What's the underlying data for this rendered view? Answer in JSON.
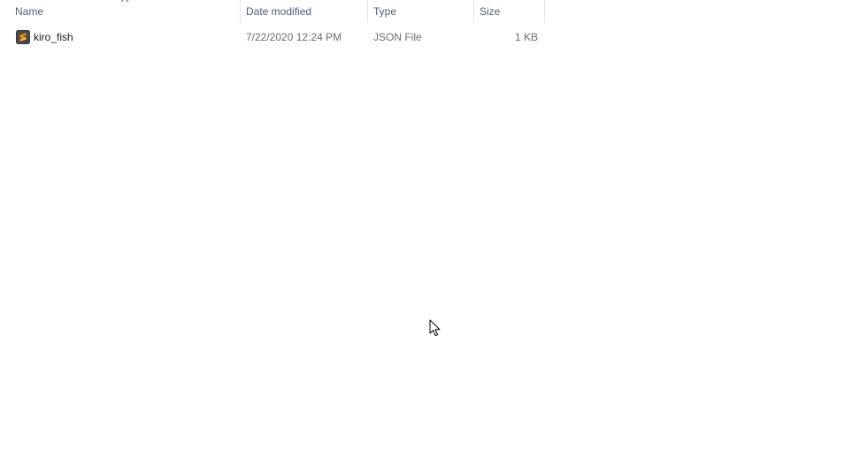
{
  "columns": {
    "name": "Name",
    "date": "Date modified",
    "type": "Type",
    "size": "Size"
  },
  "sort": {
    "column": "name",
    "direction": "ascending",
    "icon": "chevron-up-icon"
  },
  "files": [
    {
      "name": "kiro_fish",
      "date": "7/22/2020 12:24 PM",
      "type": "JSON File",
      "size": "1 KB",
      "icon": "sublime-text-file-icon",
      "icon_color": "#ff9800"
    }
  ],
  "cursor": {
    "icon": "mouse-pointer-icon"
  }
}
